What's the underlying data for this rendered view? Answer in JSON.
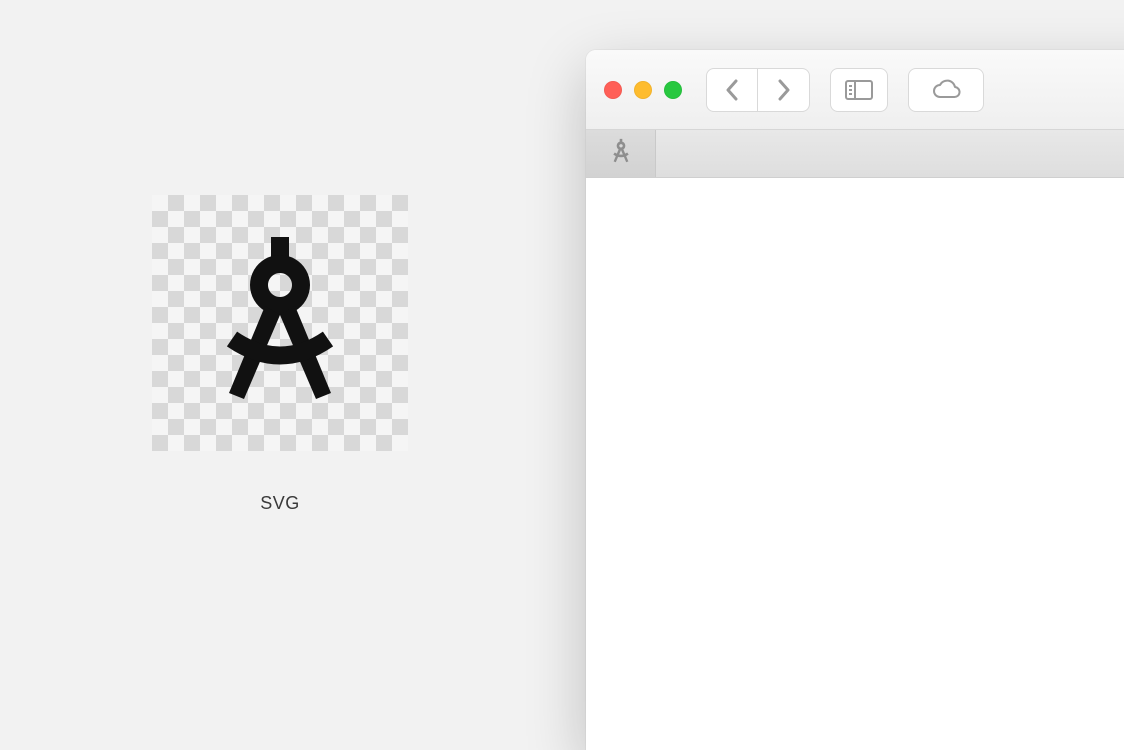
{
  "preview": {
    "label": "SVG",
    "icon": "compass-icon"
  },
  "window": {
    "toolbar": {
      "back_icon": "chevron-left-icon",
      "forward_icon": "chevron-right-icon",
      "sidebar_icon": "sidebar-toggle-icon",
      "cloud_icon": "cloud-icon"
    },
    "tabs": [
      {
        "icon": "compass-icon",
        "active": true
      }
    ]
  }
}
